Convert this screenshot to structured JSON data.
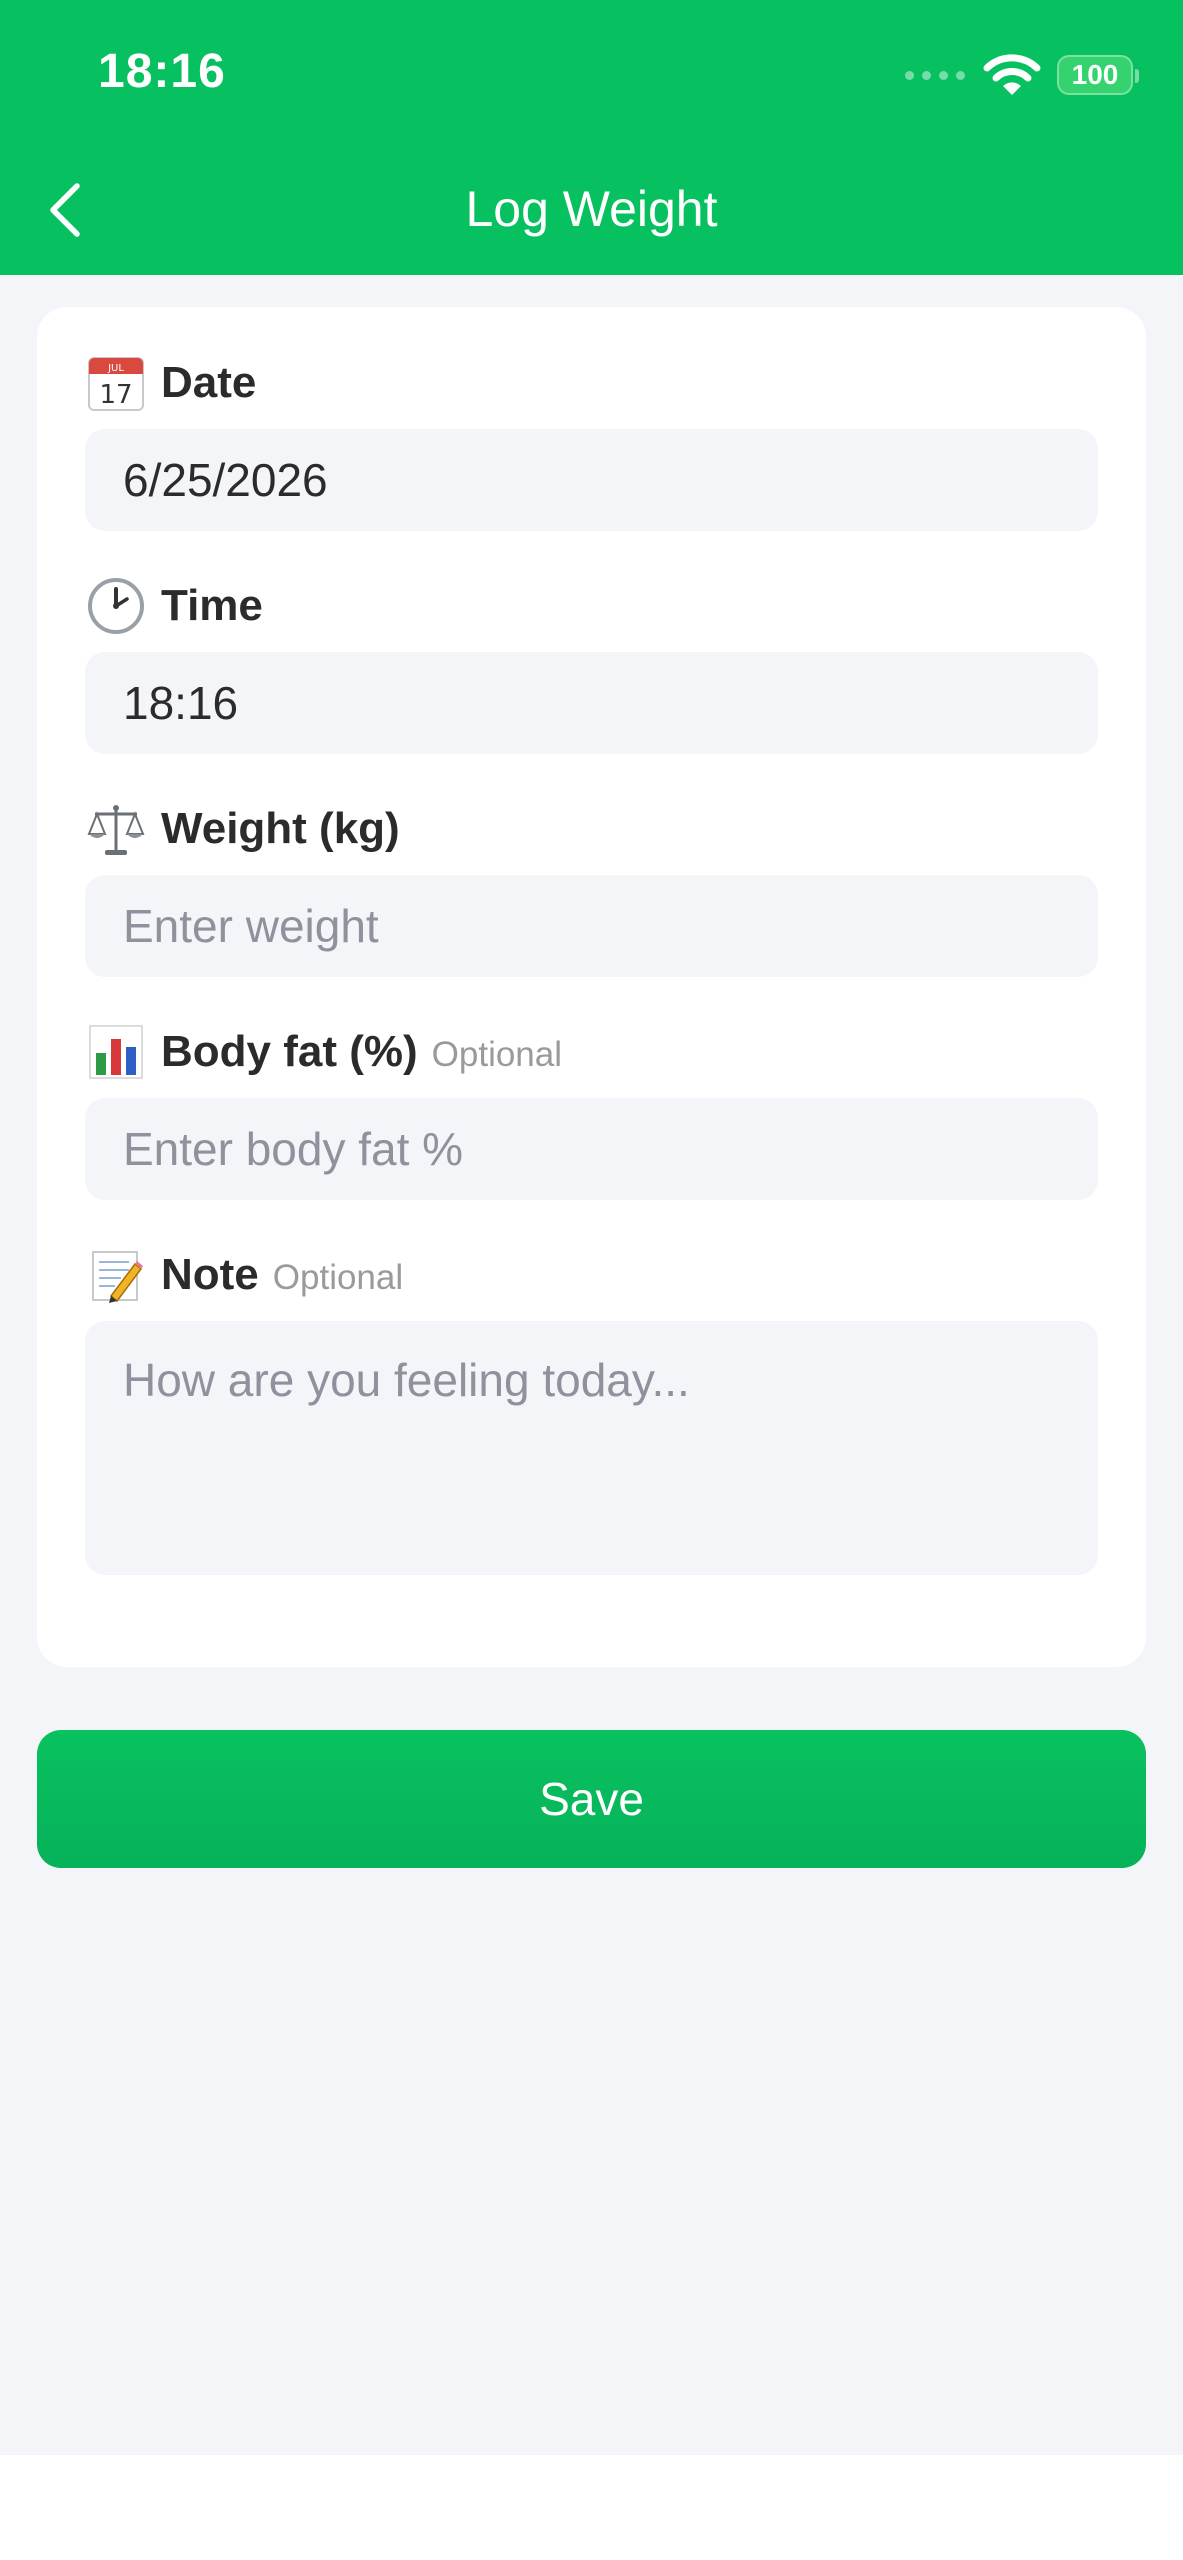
{
  "status_bar": {
    "time": "18:16",
    "battery": "100"
  },
  "header": {
    "title": "Log Weight",
    "back_icon": "chevron-left-icon",
    "background_color": "#07c160"
  },
  "form": {
    "date": {
      "icon": "calendar-icon",
      "label": "Date",
      "value": "6/25/2026"
    },
    "time": {
      "icon": "clock-icon",
      "label": "Time",
      "value": "18:16"
    },
    "weight": {
      "icon": "scale-icon",
      "label": "Weight (kg)",
      "placeholder": "Enter weight"
    },
    "body_fat": {
      "icon": "bar-chart-icon",
      "label": "Body fat (%)",
      "optional": "Optional",
      "placeholder": "Enter body fat %"
    },
    "note": {
      "icon": "memo-icon",
      "label": "Note",
      "optional": "Optional",
      "placeholder": "How are you feeling today..."
    }
  },
  "save_button": {
    "label": "Save",
    "color": "#07c160"
  }
}
